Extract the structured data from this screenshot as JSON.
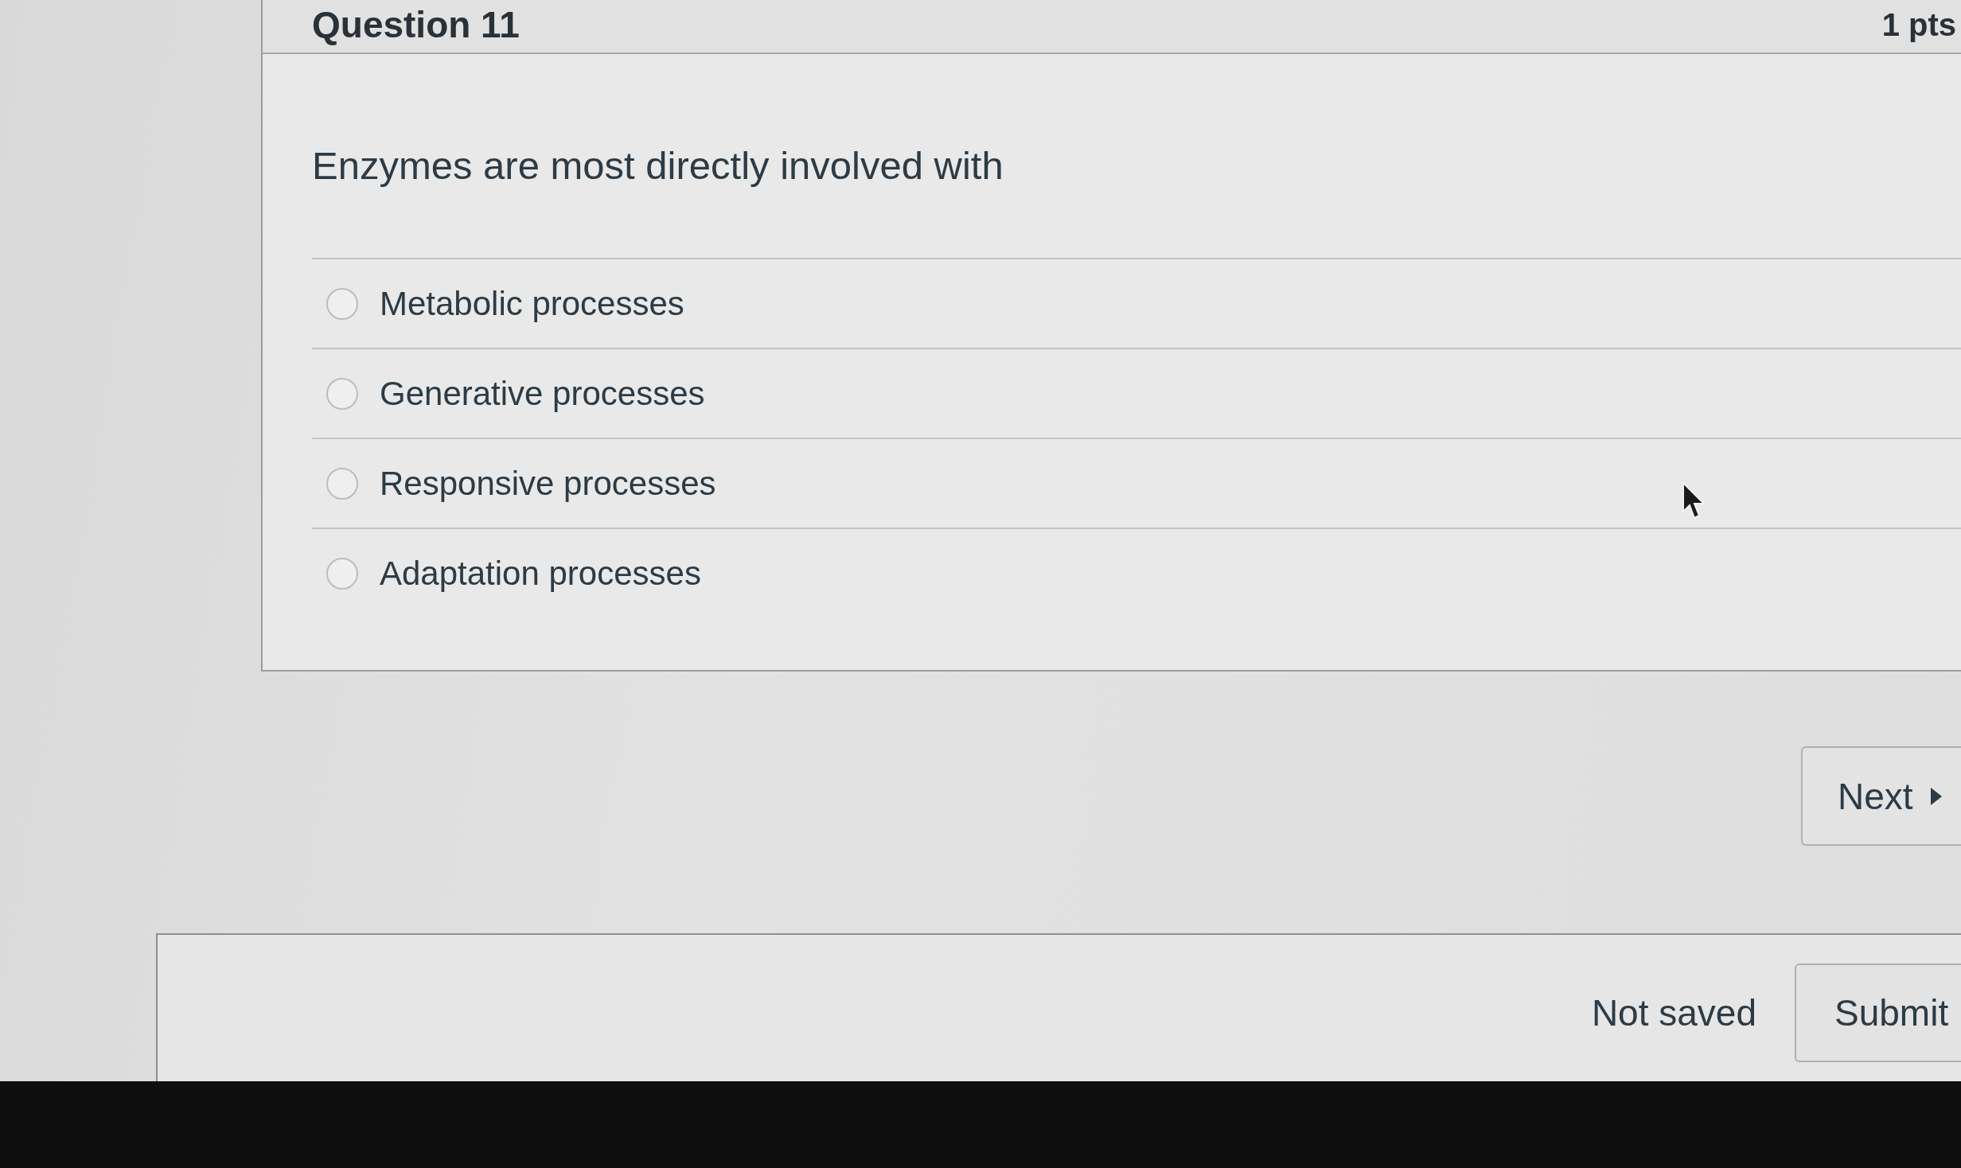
{
  "question": {
    "title": "Question 11",
    "points": "1 pts",
    "text": "Enzymes are most directly involved with",
    "options": [
      {
        "label": "Metabolic processes",
        "selected": false
      },
      {
        "label": "Generative processes",
        "selected": false
      },
      {
        "label": "Responsive processes",
        "selected": false
      },
      {
        "label": "Adaptation processes",
        "selected": false
      }
    ]
  },
  "navigation": {
    "next_button": "Next"
  },
  "footer": {
    "status": "Not saved",
    "submit_button": "Submit"
  }
}
